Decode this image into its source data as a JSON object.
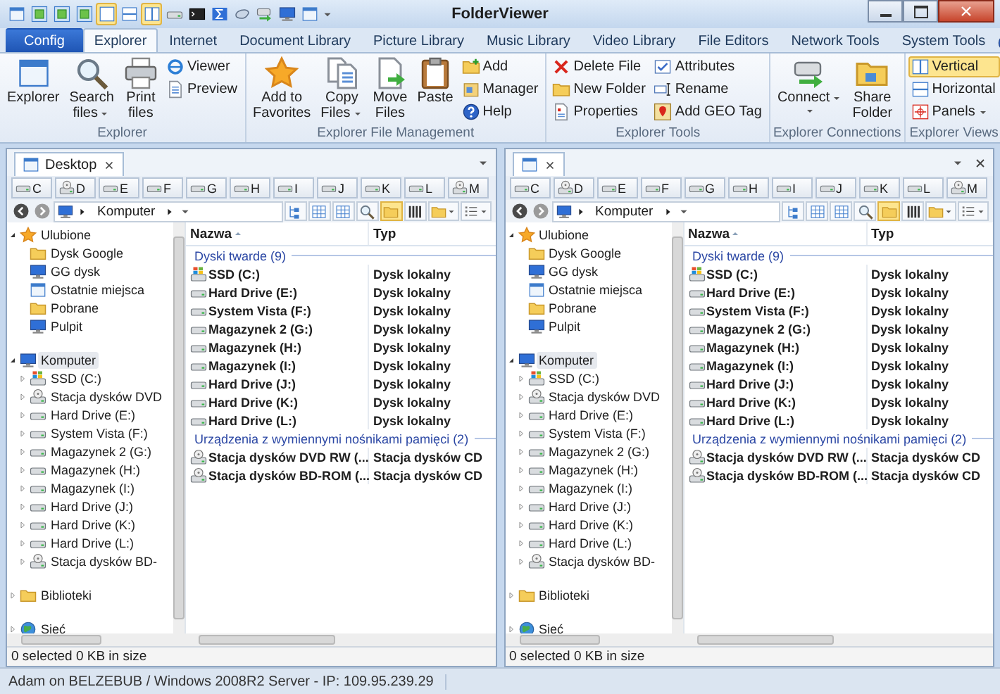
{
  "window": {
    "title": "FolderViewer"
  },
  "quick_access": [
    {
      "selected": false
    },
    {
      "selected": false
    },
    {
      "selected": false
    },
    {
      "selected": false
    },
    {
      "selected": true
    },
    {
      "selected": false
    },
    {
      "selected": true
    },
    {
      "selected": false
    },
    {
      "selected": false
    },
    {
      "selected": false
    },
    {
      "selected": false
    },
    {
      "selected": false
    },
    {
      "selected": false
    },
    {
      "selected": false
    }
  ],
  "ribbon": {
    "tabs": [
      {
        "label": "Config",
        "kind": "app",
        "selected": false
      },
      {
        "label": "Explorer",
        "kind": "tab",
        "selected": true
      },
      {
        "label": "Internet",
        "kind": "tab",
        "selected": false
      },
      {
        "label": "Document Library",
        "kind": "tab",
        "selected": false
      },
      {
        "label": "Picture Library",
        "kind": "tab",
        "selected": false
      },
      {
        "label": "Music Library",
        "kind": "tab",
        "selected": false
      },
      {
        "label": "Video Library",
        "kind": "tab",
        "selected": false
      },
      {
        "label": "File Editors",
        "kind": "tab",
        "selected": false
      },
      {
        "label": "Network Tools",
        "kind": "tab",
        "selected": false
      },
      {
        "label": "System Tools",
        "kind": "tab",
        "selected": false
      }
    ],
    "groups": [
      {
        "label": "Explorer",
        "columns": [
          {
            "kind": "large",
            "lines": [
              "Explorer"
            ]
          },
          {
            "kind": "large",
            "lines": [
              "Search",
              "files"
            ],
            "dropdown": true
          },
          {
            "kind": "large",
            "lines": [
              "Print",
              "files"
            ]
          },
          {
            "kind": "stack",
            "items": [
              {
                "label": "Viewer",
                "selected": false
              },
              {
                "label": "Preview",
                "selected": false
              }
            ]
          }
        ]
      },
      {
        "label": "Explorer File Management",
        "columns": [
          {
            "kind": "large",
            "lines": [
              "Add to",
              "Favorites"
            ]
          },
          {
            "kind": "large",
            "lines": [
              "Copy",
              "Files"
            ],
            "dropdown": true
          },
          {
            "kind": "large",
            "lines": [
              "Move",
              "Files"
            ]
          },
          {
            "kind": "large",
            "lines": [
              "Paste"
            ]
          },
          {
            "kind": "stack",
            "items": [
              {
                "label": "Add",
                "selected": false
              },
              {
                "label": "Manager",
                "selected": false
              },
              {
                "label": "Help",
                "selected": false
              }
            ]
          }
        ]
      },
      {
        "label": "Explorer Tools",
        "columns": [
          {
            "kind": "stack",
            "items": [
              {
                "label": "Delete File",
                "selected": false
              },
              {
                "label": "New Folder",
                "selected": false
              },
              {
                "label": "Properties",
                "selected": false
              }
            ]
          },
          {
            "kind": "stack",
            "items": [
              {
                "label": "Attributes",
                "selected": false
              },
              {
                "label": "Rename",
                "selected": false
              },
              {
                "label": "Add GEO Tag",
                "selected": false
              }
            ]
          }
        ]
      },
      {
        "label": "Explorer Connections",
        "columns": [
          {
            "kind": "large",
            "lines": [
              "Connect"
            ],
            "dropdown": true
          },
          {
            "kind": "large",
            "lines": [
              "Share",
              "Folder"
            ]
          }
        ]
      },
      {
        "label": "Explorer Views",
        "columns": [
          {
            "kind": "stack",
            "items": [
              {
                "label": "Vertical",
                "selected": true
              },
              {
                "label": "Horizontal",
                "selected": false
              },
              {
                "label": "Panels",
                "selected": false,
                "dropdown": true
              }
            ]
          }
        ]
      }
    ]
  },
  "panes": [
    {
      "tab": {
        "label": "Desktop"
      },
      "drives": [
        {
          "letter": "C",
          "kind": "drive"
        },
        {
          "letter": "D",
          "kind": "optical"
        },
        {
          "letter": "E",
          "kind": "drive"
        },
        {
          "letter": "F",
          "kind": "drive"
        },
        {
          "letter": "G",
          "kind": "drive"
        },
        {
          "letter": "H",
          "kind": "drive"
        },
        {
          "letter": "I",
          "kind": "drive"
        },
        {
          "letter": "J",
          "kind": "drive"
        },
        {
          "letter": "K",
          "kind": "drive"
        },
        {
          "letter": "L",
          "kind": "drive"
        },
        {
          "letter": "M",
          "kind": "optical"
        }
      ],
      "address": "Komputer",
      "view_buttons": [
        {
          "selected": false
        },
        {
          "selected": false
        },
        {
          "selected": false
        },
        {
          "selected": false
        },
        {
          "selected": true
        },
        {
          "selected": false
        },
        {
          "selected": false,
          "dropdown": true
        },
        {
          "selected": false,
          "dropdown": true
        }
      ],
      "tree": [
        {
          "label": "Ulubione",
          "kind": "favorites",
          "expanded": true,
          "selected": false,
          "children": [
            {
              "label": "Dysk Google",
              "kind": "folder",
              "selected": false
            },
            {
              "label": "GG dysk",
              "kind": "computer",
              "selected": false
            },
            {
              "label": "Ostatnie miejsca",
              "kind": "recent",
              "selected": false
            },
            {
              "label": "Pobrane",
              "kind": "folder",
              "selected": false
            },
            {
              "label": "Pulpit",
              "kind": "desktop",
              "selected": false
            }
          ]
        },
        {
          "label": "Komputer",
          "kind": "computer",
          "expanded": true,
          "selected": true,
          "children": [
            {
              "label": "SSD (C:)",
              "kind": "sysdrive",
              "expanded": false,
              "selected": false
            },
            {
              "label": "Stacja dysków DVD",
              "kind": "optical",
              "expanded": false,
              "selected": false
            },
            {
              "label": "Hard Drive (E:)",
              "kind": "drive",
              "expanded": false,
              "selected": false
            },
            {
              "label": "System Vista (F:)",
              "kind": "drive",
              "expanded": false,
              "selected": false
            },
            {
              "label": "Magazynek 2 (G:)",
              "kind": "drive",
              "expanded": false,
              "selected": false
            },
            {
              "label": "Magazynek (H:)",
              "kind": "drive",
              "expanded": false,
              "selected": false
            },
            {
              "label": "Magazynek (I:)",
              "kind": "drive",
              "expanded": false,
              "selected": false
            },
            {
              "label": "Hard Drive (J:)",
              "kind": "drive",
              "expanded": false,
              "selected": false
            },
            {
              "label": "Hard Drive (K:)",
              "kind": "drive",
              "expanded": false,
              "selected": false
            },
            {
              "label": "Hard Drive (L:)",
              "kind": "drive",
              "expanded": false,
              "selected": false
            },
            {
              "label": "Stacja dysków BD-",
              "kind": "optical",
              "expanded": false,
              "selected": false
            }
          ]
        },
        {
          "label": "Biblioteki",
          "kind": "library",
          "expanded": false,
          "selected": false
        },
        {
          "label": "Sieć",
          "kind": "network",
          "expanded": false,
          "selected": false
        }
      ],
      "columns": [
        "Nazwa",
        "Typ"
      ],
      "groups": [
        {
          "label": "Dyski twarde (9)",
          "rows": [
            {
              "name": "SSD (C:)",
              "type": "Dysk lokalny",
              "kind": "sysdrive"
            },
            {
              "name": "Hard Drive (E:)",
              "type": "Dysk lokalny",
              "kind": "drive"
            },
            {
              "name": "System Vista (F:)",
              "type": "Dysk lokalny",
              "kind": "drive"
            },
            {
              "name": "Magazynek 2 (G:)",
              "type": "Dysk lokalny",
              "kind": "drive"
            },
            {
              "name": "Magazynek (H:)",
              "type": "Dysk lokalny",
              "kind": "drive"
            },
            {
              "name": "Magazynek (I:)",
              "type": "Dysk lokalny",
              "kind": "drive"
            },
            {
              "name": "Hard Drive (J:)",
              "type": "Dysk lokalny",
              "kind": "drive"
            },
            {
              "name": "Hard Drive (K:)",
              "type": "Dysk lokalny",
              "kind": "drive"
            },
            {
              "name": "Hard Drive (L:)",
              "type": "Dysk lokalny",
              "kind": "drive"
            }
          ]
        },
        {
          "label": "Urządzenia z wymiennymi nośnikami pamięci (2)",
          "rows": [
            {
              "name": "Stacja dysków DVD RW (...",
              "type": "Stacja dysków CD",
              "kind": "optical"
            },
            {
              "name": "Stacja dysków BD-ROM (...",
              "type": "Stacja dysków CD",
              "kind": "optical"
            }
          ]
        }
      ],
      "status": "0 selected 0 KB in size"
    },
    {
      "closable": true,
      "drives": [
        {
          "letter": "C",
          "kind": "drive"
        },
        {
          "letter": "D",
          "kind": "optical"
        },
        {
          "letter": "E",
          "kind": "drive"
        },
        {
          "letter": "F",
          "kind": "drive"
        },
        {
          "letter": "G",
          "kind": "drive"
        },
        {
          "letter": "H",
          "kind": "drive"
        },
        {
          "letter": "I",
          "kind": "drive"
        },
        {
          "letter": "J",
          "kind": "drive"
        },
        {
          "letter": "K",
          "kind": "drive"
        },
        {
          "letter": "L",
          "kind": "drive"
        },
        {
          "letter": "M",
          "kind": "optical"
        }
      ],
      "address": "Komputer",
      "view_buttons": [
        {
          "selected": false
        },
        {
          "selected": false
        },
        {
          "selected": false
        },
        {
          "selected": false
        },
        {
          "selected": true
        },
        {
          "selected": false
        },
        {
          "selected": false,
          "dropdown": true
        },
        {
          "selected": false,
          "dropdown": true
        }
      ],
      "tree": [
        {
          "label": "Ulubione",
          "kind": "favorites",
          "expanded": true,
          "selected": false,
          "children": [
            {
              "label": "Dysk Google",
              "kind": "folder",
              "selected": false
            },
            {
              "label": "GG dysk",
              "kind": "computer",
              "selected": false
            },
            {
              "label": "Ostatnie miejsca",
              "kind": "recent",
              "selected": false
            },
            {
              "label": "Pobrane",
              "kind": "folder",
              "selected": false
            },
            {
              "label": "Pulpit",
              "kind": "desktop",
              "selected": false
            }
          ]
        },
        {
          "label": "Komputer",
          "kind": "computer",
          "expanded": true,
          "selected": true,
          "children": [
            {
              "label": "SSD (C:)",
              "kind": "sysdrive",
              "expanded": false,
              "selected": false
            },
            {
              "label": "Stacja dysków DVD",
              "kind": "optical",
              "expanded": false,
              "selected": false
            },
            {
              "label": "Hard Drive (E:)",
              "kind": "drive",
              "expanded": false,
              "selected": false
            },
            {
              "label": "System Vista (F:)",
              "kind": "drive",
              "expanded": false,
              "selected": false
            },
            {
              "label": "Magazynek 2 (G:)",
              "kind": "drive",
              "expanded": false,
              "selected": false
            },
            {
              "label": "Magazynek (H:)",
              "kind": "drive",
              "expanded": false,
              "selected": false
            },
            {
              "label": "Magazynek (I:)",
              "kind": "drive",
              "expanded": false,
              "selected": false
            },
            {
              "label": "Hard Drive (J:)",
              "kind": "drive",
              "expanded": false,
              "selected": false
            },
            {
              "label": "Hard Drive (K:)",
              "kind": "drive",
              "expanded": false,
              "selected": false
            },
            {
              "label": "Hard Drive (L:)",
              "kind": "drive",
              "expanded": false,
              "selected": false
            },
            {
              "label": "Stacja dysków BD-",
              "kind": "optical",
              "expanded": false,
              "selected": false
            }
          ]
        },
        {
          "label": "Biblioteki",
          "kind": "library",
          "expanded": false,
          "selected": false
        },
        {
          "label": "Sieć",
          "kind": "network",
          "expanded": false,
          "selected": false
        }
      ],
      "columns": [
        "Nazwa",
        "Typ"
      ],
      "groups": [
        {
          "label": "Dyski twarde (9)",
          "rows": [
            {
              "name": "SSD (C:)",
              "type": "Dysk lokalny",
              "kind": "sysdrive"
            },
            {
              "name": "Hard Drive (E:)",
              "type": "Dysk lokalny",
              "kind": "drive"
            },
            {
              "name": "System Vista (F:)",
              "type": "Dysk lokalny",
              "kind": "drive"
            },
            {
              "name": "Magazynek 2 (G:)",
              "type": "Dysk lokalny",
              "kind": "drive"
            },
            {
              "name": "Magazynek (H:)",
              "type": "Dysk lokalny",
              "kind": "drive"
            },
            {
              "name": "Magazynek (I:)",
              "type": "Dysk lokalny",
              "kind": "drive"
            },
            {
              "name": "Hard Drive (J:)",
              "type": "Dysk lokalny",
              "kind": "drive"
            },
            {
              "name": "Hard Drive (K:)",
              "type": "Dysk lokalny",
              "kind": "drive"
            },
            {
              "name": "Hard Drive (L:)",
              "type": "Dysk lokalny",
              "kind": "drive"
            }
          ]
        },
        {
          "label": "Urządzenia z wymiennymi nośnikami pamięci (2)",
          "rows": [
            {
              "name": "Stacja dysków DVD RW (...",
              "type": "Stacja dysków CD",
              "kind": "optical"
            },
            {
              "name": "Stacja dysków BD-ROM (...",
              "type": "Stacja dysków CD",
              "kind": "optical"
            }
          ]
        }
      ],
      "status": "0 selected 0 KB in size"
    }
  ],
  "status_bar": "Adam on BELZEBUB / Windows 2008R2 Server - IP: 109.95.239.29"
}
